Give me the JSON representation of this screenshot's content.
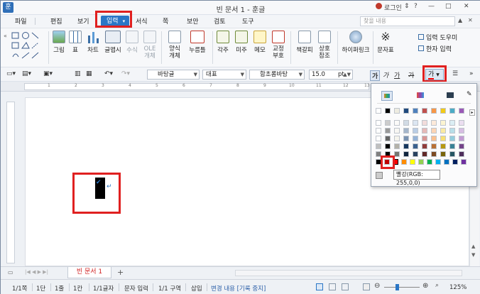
{
  "window": {
    "title": "빈 문서 1 - 훈글",
    "logo": "훈",
    "login_label": "로그인",
    "controls": [
      "⇕",
      "?",
      "—",
      "□",
      "✕"
    ]
  },
  "menu": {
    "items": [
      "파일",
      "편집",
      "보기",
      "입력",
      "서식",
      "쪽",
      "보안",
      "검토",
      "도구"
    ],
    "active": "입력",
    "search_placeholder": "찾을 내용"
  },
  "ribbon": {
    "buttons": [
      {
        "label": "그림",
        "icon": "picture-icon"
      },
      {
        "label": "표",
        "icon": "table-icon"
      },
      {
        "label": "차트",
        "icon": "chart-icon"
      },
      {
        "label": "글맵시",
        "icon": "wordart-icon"
      },
      {
        "label": "수식",
        "icon": "formula-icon"
      },
      {
        "label": "OLE 개체",
        "icon": "ole-icon"
      },
      {
        "label": "양식 개체",
        "icon": "form-icon"
      },
      {
        "label": "누름틀",
        "icon": "field-icon"
      },
      {
        "label": "각주",
        "icon": "footnote-icon"
      },
      {
        "label": "미주",
        "icon": "endnote-icon"
      },
      {
        "label": "메모",
        "icon": "memo-icon"
      },
      {
        "label": "교정 부호",
        "icon": "proof-icon"
      },
      {
        "label": "책갈피",
        "icon": "bookmark-icon"
      },
      {
        "label": "상호 참조",
        "icon": "crossref-icon"
      },
      {
        "label": "하이퍼링크",
        "icon": "hyperlink-icon"
      },
      {
        "label": "문자표",
        "icon": "symbol-icon"
      }
    ],
    "side_labels": [
      "입력 도우미",
      "한자 입력"
    ]
  },
  "format": {
    "style": "바탕글",
    "para_style": "대표",
    "font": "함초롬바탕",
    "size": "15.0",
    "size_unit": "pt",
    "char_glyphs": [
      "가",
      "가",
      "가",
      "가"
    ],
    "color_button": "가"
  },
  "ruler": {
    "ticks": [
      "1",
      "2",
      "3",
      "4",
      "5",
      "6",
      "7",
      "8",
      "9",
      "10",
      "11",
      "12",
      "13"
    ]
  },
  "color_popup": {
    "tooltip": "빨강(RGB: 255,0,0)",
    "selected_color": "#ff0000",
    "theme_colors": [
      "#ffffff",
      "#000000",
      "#eeece1",
      "#1f497d",
      "#4f81bd",
      "#c0504d",
      "#f79646",
      "#f2ca18",
      "#4bacc6",
      "#9b59b6"
    ],
    "standard_colors": [
      "#000000",
      "#c00000",
      "#ff0000",
      "#ff8c00",
      "#ffff00",
      "#92d050",
      "#00b050",
      "#00b0f0",
      "#0070c0",
      "#002060",
      "#7030a0"
    ]
  },
  "tabs": {
    "doc_tab": "빈 문서 1",
    "add": "+"
  },
  "status": {
    "items": [
      "1/1쪽",
      "1단",
      "1줄",
      "1칸",
      "1/1글자",
      "문자 입력",
      "1/1 구역",
      "삽입",
      "변경 내용 [기록 중지]"
    ],
    "zoom": "125%"
  }
}
